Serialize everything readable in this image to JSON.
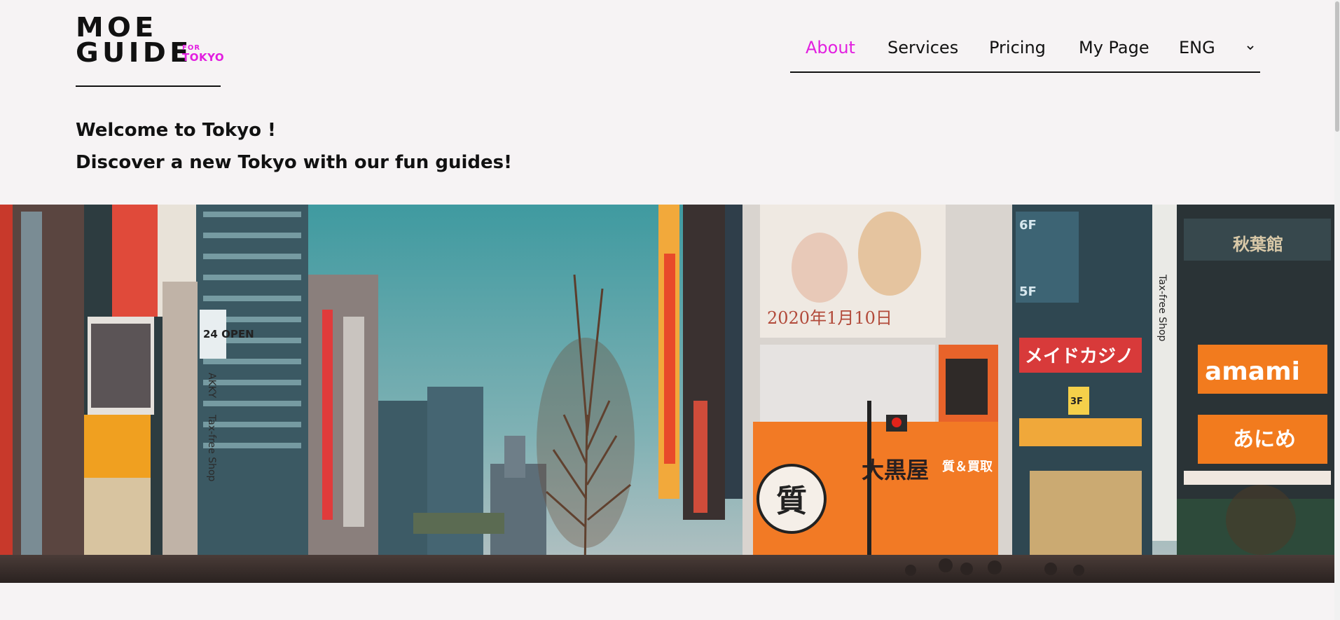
{
  "logo": {
    "line1": "MOE",
    "line2": "GUIDE",
    "for": "FOR",
    "city": "TOKYO",
    "accent": "#e21fe0"
  },
  "nav": {
    "items": [
      "About",
      "Services",
      "Pricing",
      "My Page"
    ],
    "active": "About",
    "language": "ENG",
    "language_icon": "chevron-down-icon"
  },
  "welcome": {
    "line1": "Welcome to Tokyo !",
    "line2": "Discover a new Tokyo with our fun guides!"
  },
  "hero": {
    "signs": {
      "maid": "メイドカジノ",
      "shop": "大黒屋",
      "buy": "質＆買取",
      "pawn": "質",
      "akiba": "秋葉館",
      "amami": "amami",
      "date": "2020年1月10日",
      "floor6": "6F",
      "floor5": "5F",
      "floor3": "3F",
      "open": "24 OPEN",
      "taxfree": "Tax-free Shop",
      "akky": "AKKY",
      "aniem": "あにめ"
    }
  },
  "colors": {
    "background": "#f6f3f4",
    "accent": "#e21fe0",
    "text": "#111111"
  }
}
